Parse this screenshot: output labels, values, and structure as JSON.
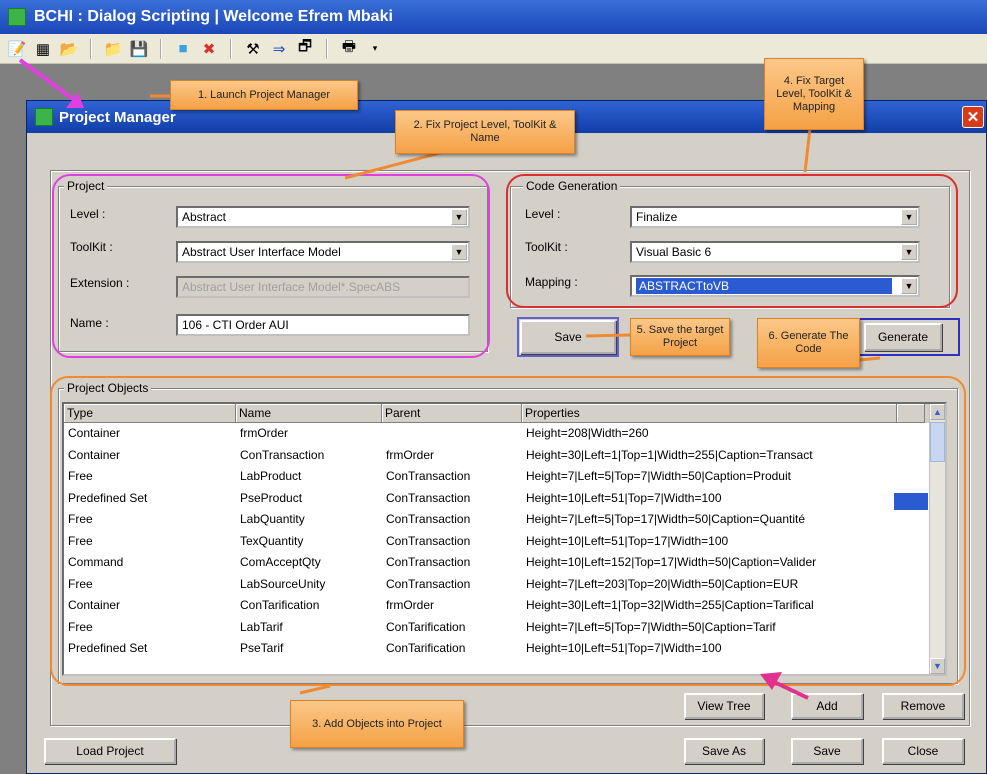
{
  "app": {
    "title": "BCHI :  Dialog Scripting   |  Welcome  Efrem Mbaki",
    "toolbar_icons": [
      "new-project-icon",
      "new-window-icon",
      "open-folder-icon",
      "open-icon",
      "save-icon",
      "run-icon",
      "close-red-icon",
      "tools-icon",
      "arrow-right-icon",
      "export-icon",
      "window-menu-icon"
    ]
  },
  "dialog": {
    "title": "Project Manager",
    "close_glyph": "✕",
    "project": {
      "title": "Project",
      "level_label": "Level :",
      "level_value": "Abstract",
      "toolkit_label": "ToolKit :",
      "toolkit_value": "Abstract User Interface Model",
      "extension_label": "Extension :",
      "extension_value": "Abstract User Interface Model*.SpecABS",
      "name_label": "Name :",
      "name_value": "106 - CTI Order AUI"
    },
    "codegen": {
      "title": "Code Generation",
      "level_label": "Level :",
      "level_value": "Finalize",
      "toolkit_label": "ToolKit :",
      "toolkit_value": "Visual Basic 6",
      "mapping_label": "Mapping :",
      "mapping_value": "ABSTRACTtoVB",
      "save_label": "Save",
      "generate_label": "Generate"
    },
    "objects": {
      "title": "Project Objects",
      "columns": [
        "Type",
        "Name",
        "Parent",
        "Properties"
      ],
      "rows": [
        [
          "Container",
          "frmOrder",
          "",
          "Height=208|Width=260"
        ],
        [
          "Container",
          "ConTransaction",
          "frmOrder",
          "Height=30|Left=1|Top=1|Width=255|Caption=Transact"
        ],
        [
          "Free",
          "LabProduct",
          "ConTransaction",
          "Height=7|Left=5|Top=7|Width=50|Caption=Produit"
        ],
        [
          "Predefined Set",
          "PseProduct",
          "ConTransaction",
          "Height=10|Left=51|Top=7|Width=100"
        ],
        [
          "Free",
          "LabQuantity",
          "ConTransaction",
          "Height=7|Left=5|Top=17|Width=50|Caption=Quantité"
        ],
        [
          "Free",
          "TexQuantity",
          "ConTransaction",
          "Height=10|Left=51|Top=17|Width=100"
        ],
        [
          "Command",
          "ComAcceptQty",
          "ConTransaction",
          "Height=10|Left=152|Top=17|Width=50|Caption=Valider"
        ],
        [
          "Free",
          "LabSourceUnity",
          "ConTransaction",
          "Height=7|Left=203|Top=20|Width=50|Caption=EUR"
        ],
        [
          "Container",
          "ConTarification",
          "frmOrder",
          "Height=30|Left=1|Top=32|Width=255|Caption=Tarifical"
        ],
        [
          "Free",
          "LabTarif",
          "ConTarification",
          "Height=7|Left=5|Top=7|Width=50|Caption=Tarif"
        ],
        [
          "Predefined Set",
          "PseTarif",
          "ConTarification",
          "Height=10|Left=51|Top=7|Width=100"
        ]
      ]
    },
    "buttons": {
      "view_tree": "View Tree",
      "add": "Add",
      "remove": "Remove",
      "load_project": "Load Project",
      "save_as": "Save As",
      "save": "Save",
      "close": "Close"
    }
  },
  "callouts": {
    "c1": "1. Launch Project Manager",
    "c2": "2. Fix Project Level, ToolKit & Name",
    "c3": "3. Add Objects into Project",
    "c4": "4. Fix Target Level, ToolKit & Mapping",
    "c5": "5. Save the target Project",
    "c6": "6. Generate The Code"
  },
  "colors": {
    "titlebar": "#1a47b8",
    "callout": "#f5a146",
    "selection": "#2a5bd0"
  }
}
